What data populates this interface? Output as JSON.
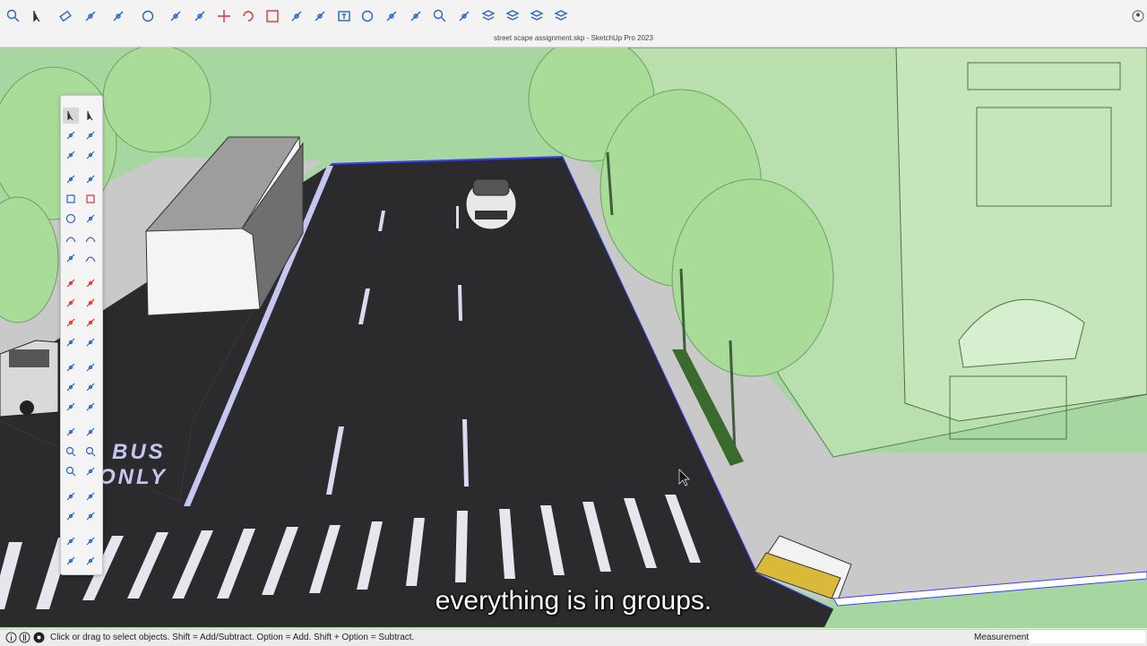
{
  "window": {
    "title": "street scape assignment.skp - SketchUp Pro 2023"
  },
  "toolbar": {
    "items": [
      {
        "icon": "search-icon",
        "label": "Search"
      },
      {
        "icon": "select-arrow-icon",
        "label": "Select"
      },
      {
        "icon": "eraser-icon",
        "label": "Eraser"
      },
      {
        "icon": "line-pencil-icon",
        "label": "Line"
      },
      {
        "icon": "freehand-arc-icon",
        "label": "Arc"
      },
      {
        "icon": "shape-circle-icon",
        "label": "Shapes"
      },
      {
        "icon": "push-pull-icon",
        "label": "Push/Pull"
      },
      {
        "icon": "offset-icon",
        "label": "Offset"
      },
      {
        "icon": "move-icon",
        "label": "Move"
      },
      {
        "icon": "rotate-icon",
        "label": "Rotate"
      },
      {
        "icon": "scale-icon",
        "label": "Scale"
      },
      {
        "icon": "tape-measure-icon",
        "label": "Tape Measure"
      },
      {
        "icon": "paint-bucket-icon",
        "label": "Paint Bucket"
      },
      {
        "icon": "text-icon",
        "label": "Text"
      },
      {
        "icon": "orbit-icon",
        "label": "Orbit"
      },
      {
        "icon": "pan-icon",
        "label": "Pan"
      },
      {
        "icon": "walk-icon",
        "label": "Walk"
      },
      {
        "icon": "zoom-icon",
        "label": "Zoom"
      },
      {
        "icon": "zoom-extents-icon",
        "label": "Zoom Extents"
      },
      {
        "icon": "components-icon",
        "label": "Components"
      },
      {
        "icon": "styles-icon",
        "label": "Styles"
      },
      {
        "icon": "layers-icon",
        "label": "Tags"
      },
      {
        "icon": "scenes-icon",
        "label": "Scenes"
      }
    ],
    "profile_icon": "user-circle-icon"
  },
  "palette": {
    "tools": [
      "select-icon",
      "lasso-select-icon",
      "paint-icon",
      "eraser-icon",
      "tag-icon",
      "tape-icon",
      "pencil-icon",
      "freehand-icon",
      "rectangle-icon",
      "rotated-rect-icon",
      "circle-icon",
      "polygon-icon",
      "arc-icon",
      "arc-3pt-icon",
      "pie-icon",
      "arc-2pt-icon",
      "move-icon",
      "push-pull-icon",
      "rotate-icon",
      "follow-me-icon",
      "scale-icon",
      "offset-icon",
      "axes-icon",
      "protractor-icon",
      "section-plane-icon",
      "dimension-icon",
      "tape-measure-icon",
      "text-3d-icon",
      "orbit-icon",
      "text-label-icon",
      "walk-icon",
      "position-camera-icon",
      "zoom-icon",
      "zoom-window-icon",
      "zoom-extents-icon",
      "look-around-icon",
      "user-icon",
      "walker-icon",
      "eye-icon",
      "sound-icon",
      "components-icon",
      "styles-icon",
      "layers-icon",
      "materials-icon"
    ]
  },
  "scene": {
    "road_marking": [
      "BUS",
      "ONLY"
    ]
  },
  "caption": "everything is in groups.",
  "status_bar": {
    "hint": "Click or drag to select objects. Shift = Add/Subtract. Option = Add. Shift + Option = Subtract.",
    "measurements_label": "Measurements",
    "measurements_value": ""
  },
  "colors": {
    "road": "#2b2a2c",
    "sidewalk": "#cbcbcb",
    "ground": "#a7d7a0",
    "building": "#bfe3b4",
    "selection": "#3d3dff"
  }
}
